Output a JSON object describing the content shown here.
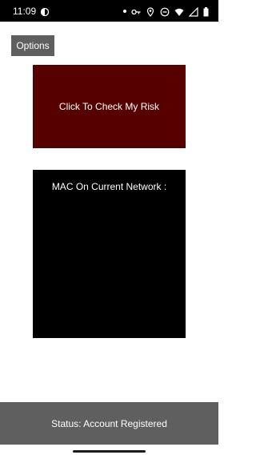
{
  "status_bar": {
    "time": "11:09",
    "left_icons": [
      "do-not-disturb-moon-icon"
    ],
    "right_icons": [
      "notification-dot-icon",
      "key-icon",
      "location-pin-icon",
      "minus-circle-icon",
      "wifi-icon",
      "signal-icon",
      "battery-icon"
    ]
  },
  "toolbar": {
    "options_label": "Options"
  },
  "main": {
    "risk_button_label": "Click To Check My Risk",
    "mac_label": "MAC On Current Network :"
  },
  "footer": {
    "status_text": "Status: Account Registered"
  },
  "colors": {
    "risk_button_bg": "#560000",
    "panel_bg": "#000000",
    "button_gray": "#5f5f5f"
  }
}
